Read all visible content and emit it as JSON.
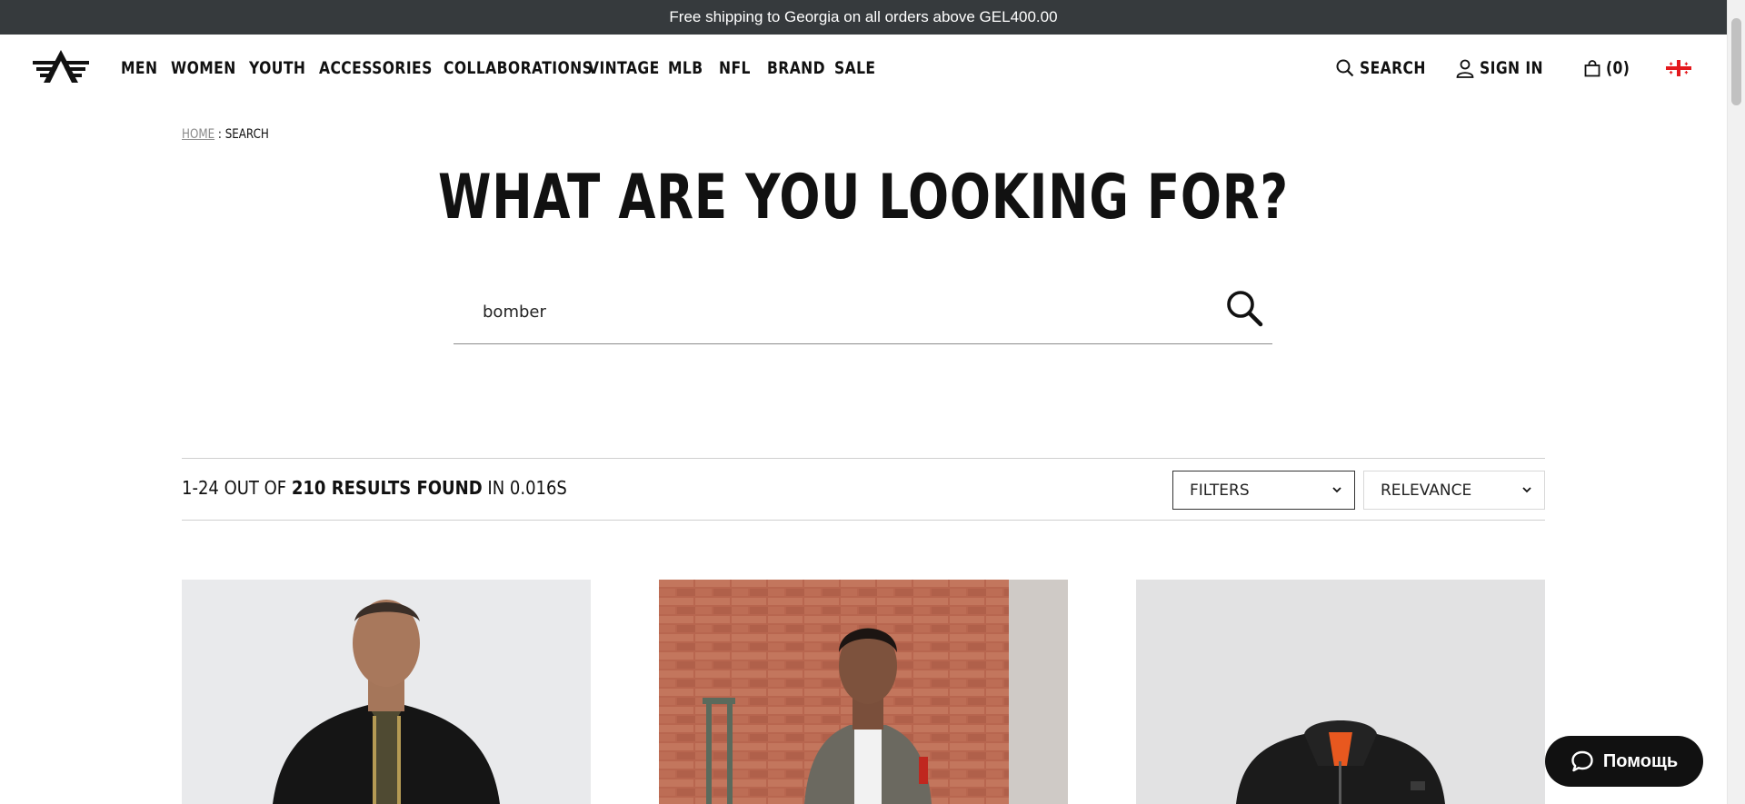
{
  "announcement": {
    "text": "Free shipping to Georgia on all orders above GEL400.00"
  },
  "nav": {
    "items": [
      {
        "label": "MEN"
      },
      {
        "label": "WOMEN"
      },
      {
        "label": "YOUTH"
      },
      {
        "label": "ACCESSORIES"
      },
      {
        "label": "COLLABORATIONS"
      },
      {
        "label": "VINTAGE"
      },
      {
        "label": "MLB"
      },
      {
        "label": "NFL"
      },
      {
        "label": "BRAND"
      },
      {
        "label": "SALE"
      }
    ]
  },
  "utility": {
    "search_label": "SEARCH",
    "signin_label": "SIGN IN",
    "cart_label": "(0)",
    "country_flag_icon": "georgia-flag-icon"
  },
  "breadcrumb": {
    "home": "HOME",
    "separator": " : ",
    "current": "SEARCH"
  },
  "page": {
    "title": "WHAT ARE YOU LOOKING FOR?"
  },
  "search": {
    "value": "bomber",
    "submit_icon": "search-icon"
  },
  "results": {
    "range": "1-24 OUT OF ",
    "count": "210 RESULTS FOUND",
    "time": " IN 0.016S",
    "filters_label": "FILTERS",
    "sort_label": "RELEVANCE"
  },
  "products": [
    {
      "image": "man-black-bomber-jacket"
    },
    {
      "image": "woman-grey-bomber-jacket-brick-wall"
    },
    {
      "image": "black-bomber-jacket-flatlay"
    }
  ],
  "help": {
    "label": "Помощь"
  },
  "colors": {
    "announcement_bg": "#363a3d",
    "text": "#111111",
    "accent_orange": "#e8581f",
    "help_bg": "#111111"
  }
}
